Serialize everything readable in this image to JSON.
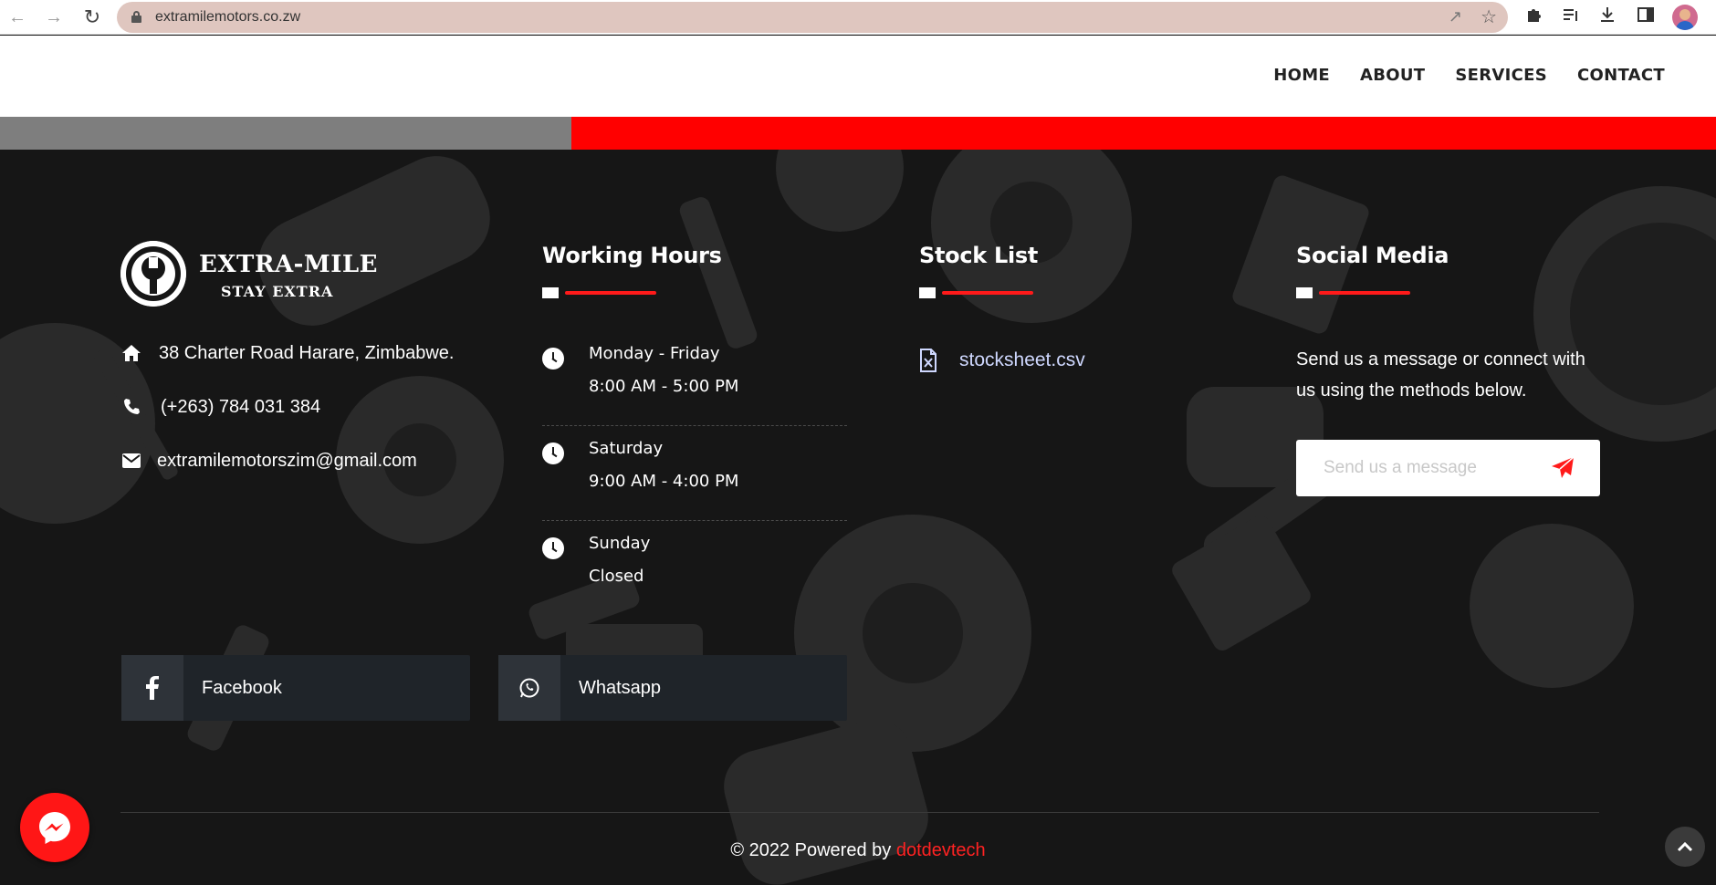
{
  "browser": {
    "url": "extramilemotors.co.zw",
    "nav_icons": {
      "back": "arrow-left-icon",
      "forward": "arrow-right-icon",
      "reload": "reload-icon"
    }
  },
  "header": {
    "nav": [
      {
        "label": "HOME"
      },
      {
        "label": "ABOUT"
      },
      {
        "label": "SERVICES"
      },
      {
        "label": "CONTACT"
      }
    ]
  },
  "footer": {
    "logo": {
      "name": "EXTRA-MILE",
      "tagline": "STAY EXTRA"
    },
    "contact": {
      "address": "38 Charter Road Harare, Zimbabwe.",
      "phone": "(+263) 784 031 384",
      "email": "extramilemotorszim@gmail.com"
    },
    "working_hours": {
      "title": "Working Hours",
      "rows": [
        {
          "day": "Monday - Friday",
          "time": "8:00 AM - 5:00 PM"
        },
        {
          "day": "Saturday",
          "time": "9:00 AM - 4:00 PM"
        },
        {
          "day": "Sunday",
          "time": "Closed"
        }
      ]
    },
    "stock_list": {
      "title": "Stock List",
      "file": "stocksheet.csv"
    },
    "social_media": {
      "title": "Social Media",
      "text": "Send us a message or connect with us using the methods below.",
      "message_placeholder": "Send us a message"
    },
    "social_buttons": [
      {
        "label": "Facebook",
        "icon": "facebook-icon"
      },
      {
        "label": "Whatsapp",
        "icon": "whatsapp-icon"
      }
    ],
    "copyright": {
      "prefix": "© 2022 Powered by ",
      "brand": "dotdevtech"
    }
  },
  "colors": {
    "accent_red": "#ff0000",
    "footer_bg": "#161616",
    "link_blue": "#cfd8ff"
  }
}
